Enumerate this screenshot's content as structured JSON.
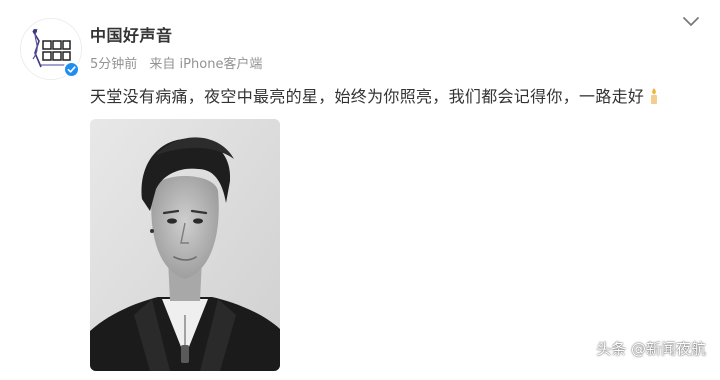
{
  "account": {
    "name": "中国好声音",
    "verified": true,
    "avatar_icon": "zhongguo-haoshengyin-logo"
  },
  "post": {
    "time": "5分钟前",
    "source": "来自 iPhone客户端",
    "text": "天堂没有病痛，夜空中最亮的星，始终为你照亮，我们都会记得你，一路走好",
    "emoji_icon": "candle-emoji"
  },
  "watermark": {
    "text": "头条 @新闻夜航"
  },
  "colors": {
    "username": "#333333",
    "meta": "#939393",
    "verified": "#1f8ef1",
    "text": "#333333"
  },
  "icons": {
    "more": "chevron-down-icon",
    "verified": "verified-badge-icon"
  }
}
